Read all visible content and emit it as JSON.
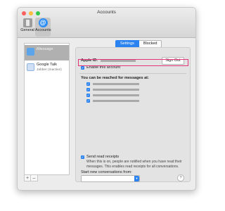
{
  "window": {
    "title": "Accounts"
  },
  "toolbar": {
    "general_label": "General",
    "accounts_label": "Accounts"
  },
  "sidebar": {
    "accounts": [
      {
        "name": "iMessage",
        "subtitle": "",
        "icon": "imessage-icon"
      },
      {
        "name": "Google Talk",
        "subtitle": "Jabber (Inactive)",
        "icon": "chat-icon"
      }
    ],
    "add_label": "+",
    "remove_label": "–"
  },
  "tabs": {
    "settings": "Settings",
    "blocked": "Blocked"
  },
  "settings": {
    "apple_id_label": "Apple ID:",
    "sign_out_label": "Sign Out",
    "enable_account_label": "Enable this account",
    "reach_label": "You can be reached for messages at:",
    "read_receipts_label": "Send read receipts",
    "read_receipts_desc": "When this is on, people are notified when you have read their messages. This enables read receipts for all conversations.",
    "start_convo_label": "Start new conversations from:",
    "help_label": "?"
  },
  "colors": {
    "accent": "#2b83f1",
    "highlight": "#e3347c"
  }
}
